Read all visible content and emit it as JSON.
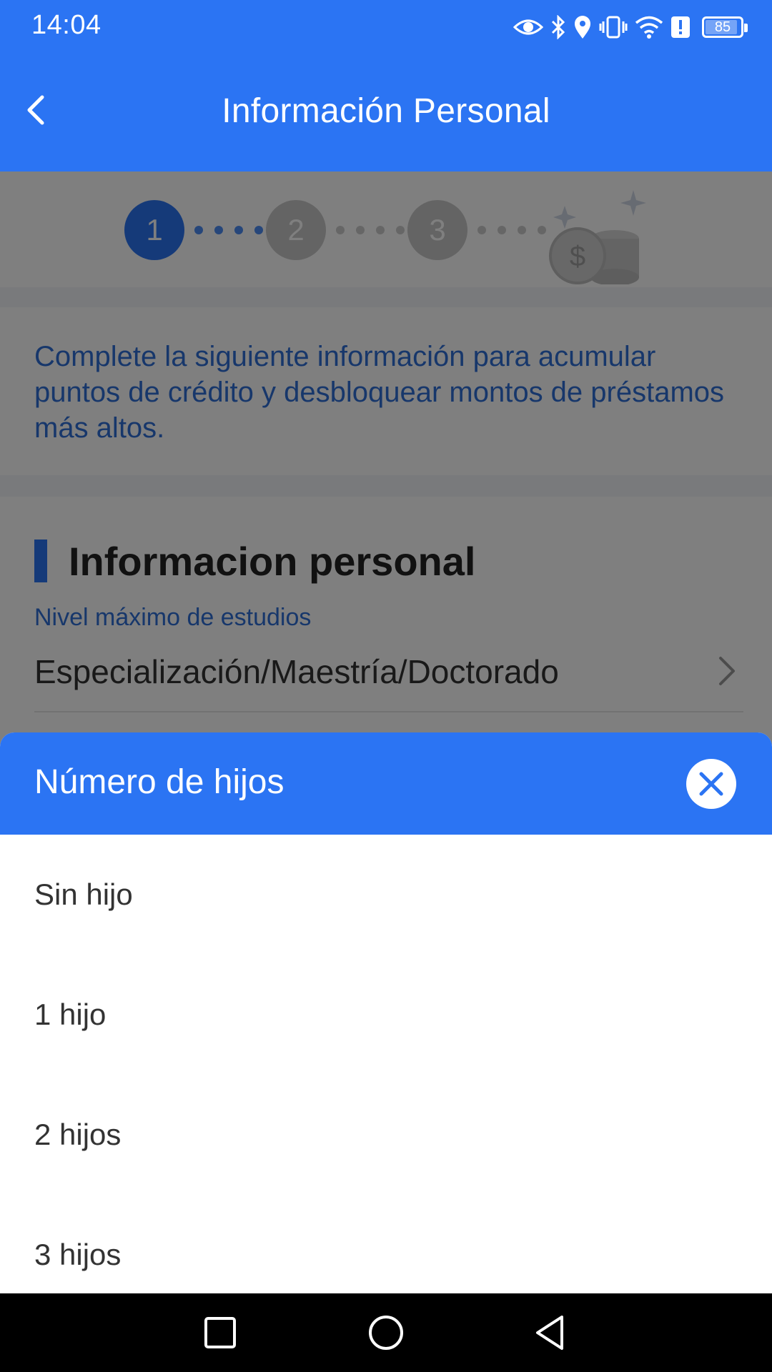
{
  "status_bar": {
    "time": "14:04",
    "battery": "85",
    "battery_level_percent": 85,
    "icons": [
      "eye-icon",
      "bluetooth-icon",
      "location-icon",
      "vibrate-icon",
      "wifi-icon",
      "alert-icon",
      "battery-icon"
    ]
  },
  "app_bar": {
    "title": "Información Personal",
    "back_icon": "chevron-left-icon"
  },
  "stepper": {
    "steps": [
      "1",
      "2",
      "3"
    ],
    "active_step": "1"
  },
  "info": {
    "text": "Complete la siguiente información para acumular puntos de crédito y desbloquear montos de préstamos más altos."
  },
  "form": {
    "section_title": "Informacion personal",
    "field_label": "Nivel máximo de estudios",
    "field_value": "Especialización/Maestría/Doctorado"
  },
  "sheet": {
    "title": "Número de hijos",
    "options": [
      "Sin hijo",
      "1 hijo",
      "2 hijos",
      "3 hijos"
    ]
  },
  "colors": {
    "primary": "#2b74f3",
    "info_text": "#2f6ed6",
    "overlay": "rgba(0,0,0,0.5)"
  }
}
